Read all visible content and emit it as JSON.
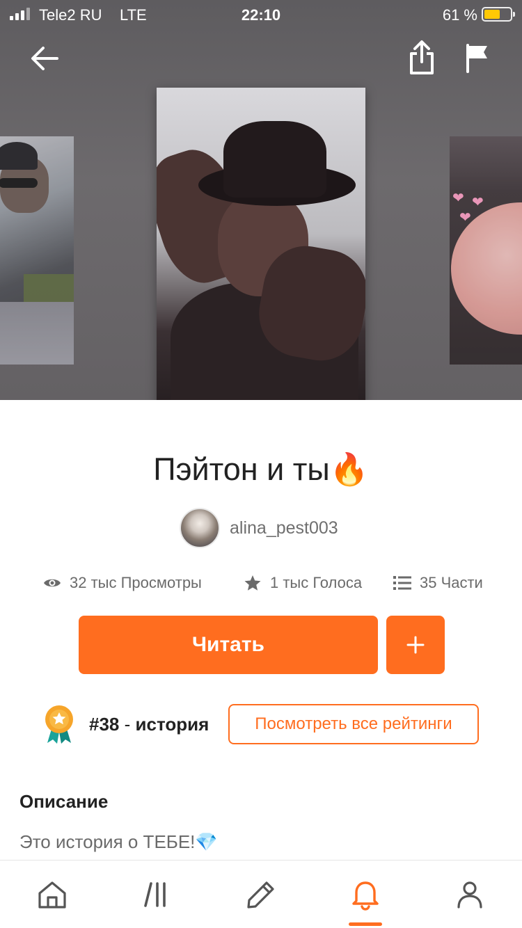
{
  "status_bar": {
    "carrier": "Tele2 RU",
    "network": "LTE",
    "time": "22:10",
    "battery_percent": "61 %",
    "battery_level": 0.61,
    "battery_color": "#ffc804"
  },
  "header": {
    "back_icon": "arrow-left-icon",
    "share_icon": "share-icon",
    "report_icon": "flag-icon"
  },
  "story": {
    "title": "Пэйтон и ты🔥",
    "author": "alina_pest003",
    "stats": {
      "views": "32 тыс Просмотры",
      "votes": "1 тыс Голоса",
      "parts": "35 Части"
    },
    "read_label": "Читать",
    "add_label": "+",
    "ranking": {
      "number": "#38",
      "separator": " - ",
      "tag": "история",
      "all_rankings_label": "Посмотреть все рейтинги"
    },
    "description": {
      "heading": "Описание",
      "text": "Это история о ТЕБЕ!💎"
    }
  },
  "bottom_nav": {
    "items": [
      {
        "name": "home",
        "icon": "home-icon"
      },
      {
        "name": "browse",
        "icon": "library-icon"
      },
      {
        "name": "write",
        "icon": "pencil-icon"
      },
      {
        "name": "notifications",
        "icon": "bell-icon",
        "active": true
      },
      {
        "name": "profile",
        "icon": "person-icon"
      }
    ]
  },
  "colors": {
    "accent": "#ff6d1f",
    "text_primary": "#222222",
    "text_secondary": "#6a6a6a"
  }
}
